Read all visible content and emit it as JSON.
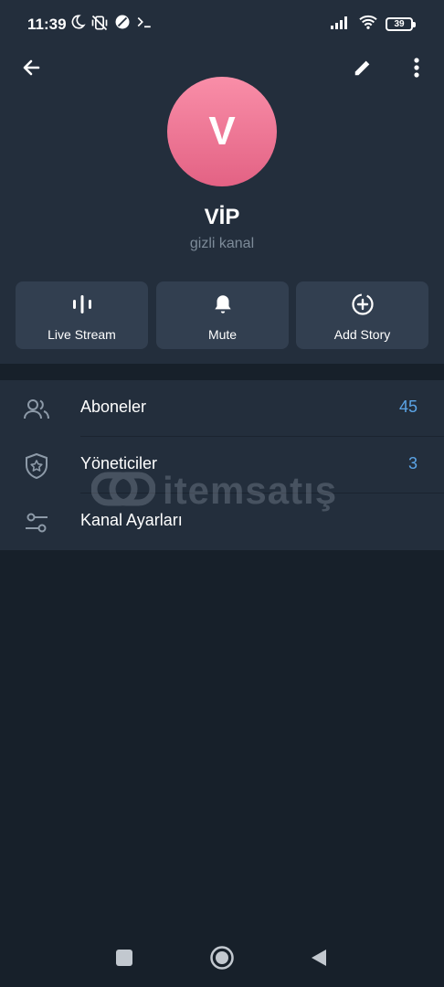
{
  "status_bar": {
    "time": "11:39",
    "battery": "39",
    "icons": [
      "moon-icon",
      "vibrate-off-icon",
      "no-disturb-icon",
      "terminal-icon",
      "signal-icon",
      "wifi-icon",
      "battery-icon"
    ]
  },
  "toolbar": {
    "back_icon": "arrow-left-icon",
    "edit_icon": "pencil-icon",
    "more_icon": "dots-vertical-icon"
  },
  "channel": {
    "avatar_letter": "V",
    "title": "VİP",
    "subtitle": "gizli kanal"
  },
  "actions": [
    {
      "label": "Live Stream",
      "icon": "live-stream-icon"
    },
    {
      "label": "Mute",
      "icon": "bell-icon"
    },
    {
      "label": "Add Story",
      "icon": "add-story-icon"
    }
  ],
  "list": [
    {
      "label": "Aboneler",
      "value": "45",
      "icon": "people-icon"
    },
    {
      "label": "Yöneticiler",
      "value": "3",
      "icon": "shield-star-icon"
    },
    {
      "label": "Kanal Ayarları",
      "value": "",
      "icon": "sliders-icon"
    }
  ],
  "watermark": {
    "text": "itemsatış"
  },
  "nav": [
    "square-icon",
    "home-circle-icon",
    "back-triangle-icon"
  ],
  "colors": {
    "header_bg": "#232e3c",
    "page_bg": "#17202a",
    "button_bg": "#323f50",
    "accent": "#5ba4e6",
    "avatar_top": "#f98ea8",
    "avatar_bottom": "#e36284"
  }
}
